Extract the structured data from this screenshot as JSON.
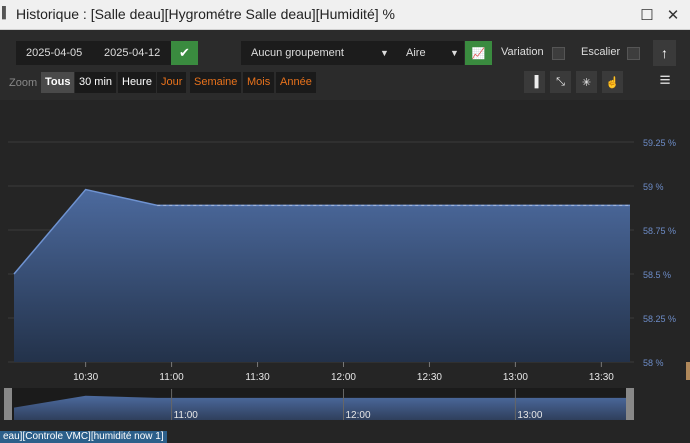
{
  "window": {
    "title_mark": "▌",
    "title": "Historique : [Salle deau][Hygrométre Salle deau][Humidité] %",
    "maximize_glyph": "☐",
    "close_glyph": "✕"
  },
  "toolbar": {
    "date_start": "2025-04-05",
    "date_end": "2025-04-12",
    "apply_glyph": "✔",
    "grouping": "Aucun groupement",
    "chart_type": "Aire",
    "chart_icon_glyph": "📈",
    "variation_label": "Variation",
    "stair_label": "Escalier",
    "up_glyph": "↑",
    "menu_glyph": "≡"
  },
  "zoom": {
    "label": "Zoom",
    "buttons": [
      {
        "label": "Tous",
        "active": true,
        "color": "#ffffff"
      },
      {
        "label": "30 min",
        "active": false,
        "color": "#ffffff"
      },
      {
        "label": "Heure",
        "active": false,
        "color": "#ffffff"
      },
      {
        "label": "Jour",
        "active": false,
        "color": "#e8721c"
      },
      {
        "label": "Semaine",
        "active": false,
        "color": "#e8721c"
      },
      {
        "label": "Mois",
        "active": false,
        "color": "#e8721c"
      },
      {
        "label": "Année",
        "active": false,
        "color": "#e8721c"
      }
    ]
  },
  "tools": [
    "▐",
    "⤡",
    "✳",
    "☝"
  ],
  "colors": {
    "accent_green": "#3a8b3f",
    "series": "#4a6ea8",
    "axis_label": "#6d8cc7"
  },
  "status": "eau][Controle VMC][humidité now 1]",
  "chart_data": {
    "type": "area",
    "x": [
      "10:05",
      "10:30",
      "10:55",
      "13:40"
    ],
    "values": [
      58.5,
      58.98,
      58.89,
      58.89
    ],
    "xticks": [
      "10:30",
      "11:00",
      "11:30",
      "12:00",
      "12:30",
      "13:00",
      "13:30"
    ],
    "navigator_ticks": [
      "11:00",
      "12:00",
      "13:00"
    ],
    "yticks": [
      "58 %",
      "58.25 %",
      "58.5 %",
      "58.75 %",
      "59 %",
      "59.25 %"
    ],
    "ylim": [
      58,
      59.25
    ],
    "grid": true,
    "yaxis_side": "right"
  }
}
